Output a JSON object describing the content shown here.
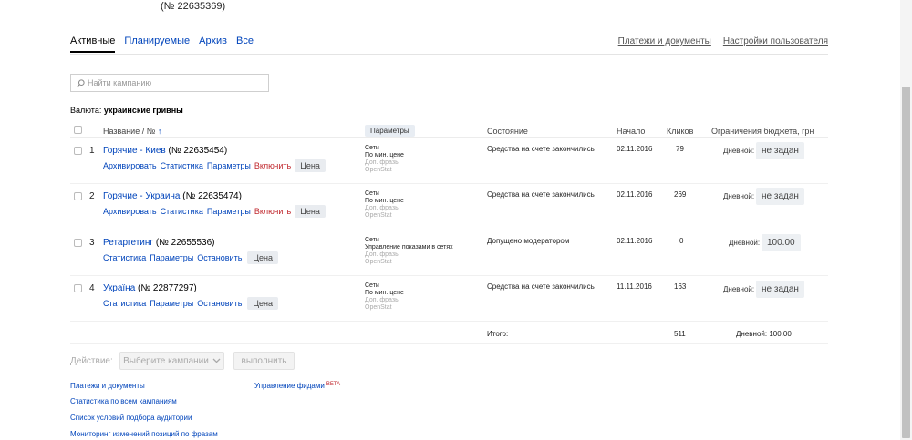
{
  "header": {
    "campaign_number": "(№ 22635369)"
  },
  "tabs": [
    {
      "label": "Активные",
      "active": true
    },
    {
      "label": "Планируемые",
      "active": false
    },
    {
      "label": "Архив",
      "active": false
    },
    {
      "label": "Все",
      "active": false
    }
  ],
  "top_links": {
    "payments": "Платежи и документы",
    "user_settings": "Настройки пользователя"
  },
  "search": {
    "placeholder": "Найти кампанию",
    "icon": "search-icon"
  },
  "currency": {
    "label": "Валюта:",
    "value": "украинские гривны"
  },
  "table": {
    "columns": {
      "name": "Название / № ",
      "name_sort": "↑",
      "params": "Параметры",
      "state": "Состояние",
      "start": "Начало",
      "clicks": "Кликов",
      "budget": "Ограничения бюджета, грн"
    },
    "rows": [
      {
        "num": "1",
        "title": "Горячие - Киев",
        "id": "(№ 22635454)",
        "actions": [
          "Архивировать",
          "Статистика",
          "Параметры"
        ],
        "toggle": "Включить",
        "price": "Цена",
        "params": [
          "Сети",
          "По мин. цене"
        ],
        "params_muted": [
          "Доп. фразы",
          "OpenStat"
        ],
        "state": "Средства на счете закончились",
        "start": "02.11.2016",
        "clicks": "79",
        "budget_label": "Дневной:",
        "budget_value": "не задан"
      },
      {
        "num": "2",
        "title": "Горячие - Украина",
        "id": "(№ 22635474)",
        "actions": [
          "Архивировать",
          "Статистика",
          "Параметры"
        ],
        "toggle": "Включить",
        "price": "Цена",
        "params": [
          "Сети",
          "По мин. цене"
        ],
        "params_muted": [
          "Доп. фразы",
          "OpenStat"
        ],
        "state": "Средства на счете закончились",
        "start": "02.11.2016",
        "clicks": "269",
        "budget_label": "Дневной:",
        "budget_value": "не задан"
      },
      {
        "num": "3",
        "title": "Ретаргетинг",
        "id": "(№ 22655536)",
        "actions": [
          "Статистика",
          "Параметры",
          "Остановить"
        ],
        "toggle": "",
        "price": "Цена",
        "params": [
          "Сети",
          "Управление показами в сетях"
        ],
        "params_muted": [
          "Доп. фразы",
          "OpenStat"
        ],
        "state": "Допущено модератором",
        "start": "02.11.2016",
        "clicks": "0",
        "budget_label": "Дневной:",
        "budget_value": "100.00"
      },
      {
        "num": "4",
        "title": "Україна",
        "id": "(№ 22877297)",
        "actions": [
          "Статистика",
          "Параметры",
          "Остановить"
        ],
        "toggle": "",
        "price": "Цена",
        "params": [
          "Сети",
          "По мин. цене"
        ],
        "params_muted": [
          "Доп. фразы",
          "OpenStat"
        ],
        "state": "Средства на счете закончились",
        "start": "11.11.2016",
        "clicks": "163",
        "budget_label": "Дневной:",
        "budget_value": "не задан"
      }
    ],
    "total": {
      "label": "Итого:",
      "clicks": "511",
      "budget": "Дневной: 100.00"
    }
  },
  "bulk": {
    "label": "Действие:",
    "select": "Выберите кампании",
    "execute": "выполнить"
  },
  "footer": {
    "links_left": [
      "Платежи и документы",
      "Статистика по всем кампаниям",
      "Список условий подбора аудитории",
      "Мониторинг изменений позиций по фразам"
    ],
    "feeds": "Управление фидами",
    "beta": "BETA"
  },
  "colors": {
    "link": "#0044bb",
    "danger": "#c0272d",
    "muted": "#aaaaaa"
  }
}
